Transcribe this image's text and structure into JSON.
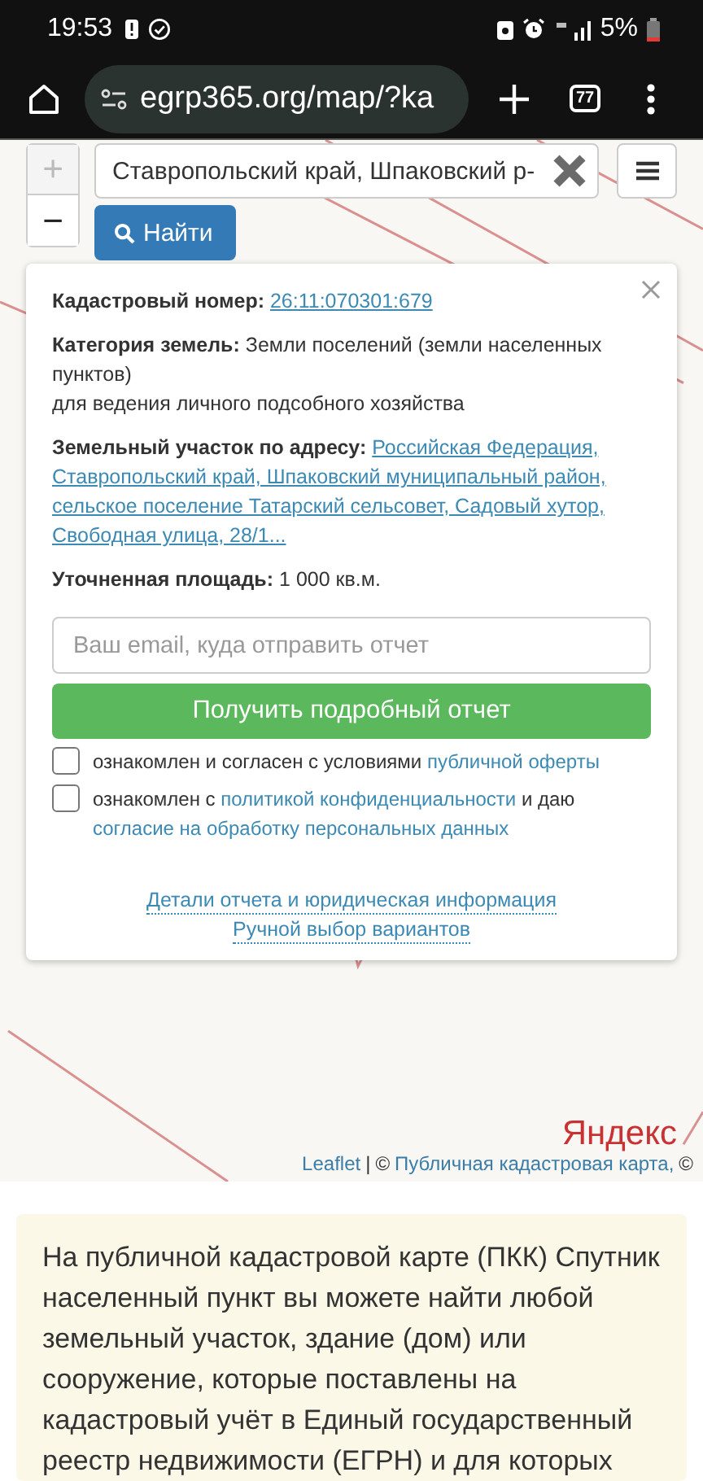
{
  "status_bar": {
    "time": "19:53",
    "battery": "5%"
  },
  "browser": {
    "url": "egrp365.org/map/?ka",
    "tab_count": "77"
  },
  "map": {
    "zoom_buttons": [
      {
        "label": "+",
        "disabled": true
      },
      {
        "label": "−",
        "disabled": false
      }
    ],
    "search": {
      "value": "Ставропольский край, Шпаковский р-"
    },
    "find_button": "Найти",
    "popup": {
      "fields": [
        {
          "label": "Кадастровый номер:",
          "values": [
            "26:11:070301:679"
          ],
          "link": true
        },
        {
          "label": "Категория земель:",
          "values": [
            "Земли поселений (земли населенных пунктов)",
            "для ведения личного подсобного хозяйства"
          ],
          "link": false
        },
        {
          "label": "Земельный участок по адресу:",
          "values": [
            "Российская Федерация, Ставропольский край, Шпаковский муниципальный район, сельское поселение Татарский сельсовет, Садовый хутор, Свободная улица, 28/1..."
          ],
          "link": true
        },
        {
          "label": "Уточненная площадь:",
          "values": [
            "1 000 кв.м."
          ],
          "link": false
        }
      ],
      "email": {
        "placeholder": "Ваш email, куда отправить отчет"
      },
      "submit_button": "Получить подробный отчет",
      "consents": [
        {
          "checked": false,
          "parts": [
            {
              "kind": "text",
              "text": "ознакомлен и согласен с условиями"
            },
            {
              "kind": "link",
              "text": "публичной оферты"
            }
          ]
        },
        {
          "checked": false,
          "parts": [
            {
              "kind": "text",
              "text": "ознакомлен с"
            },
            {
              "kind": "link",
              "text": "политикой конфиденциальности"
            },
            {
              "kind": "text",
              "text": "и даю"
            },
            {
              "kind": "link",
              "text": "согласие на обработку персональных данных"
            }
          ]
        }
      ],
      "links": [
        "Детали отчета и юридическая информация",
        "Ручной выбор вариантов"
      ]
    },
    "logo": "Яндекс",
    "attribution": {
      "link": "Leaflet",
      "separator": "|",
      "text": "©",
      "source_link": "Публичная кадастровая карта,",
      "tail": "©"
    }
  },
  "article": {
    "text": "На публичной кадастровой карте (ПКК) Спутник населенный пункт вы можете найти любой земельный участок, здание (дом) или сооружение, которые поставлены на кадастровый учёт в Единый государственный реестр недвижимости (ЕГРН) и для которых"
  }
}
